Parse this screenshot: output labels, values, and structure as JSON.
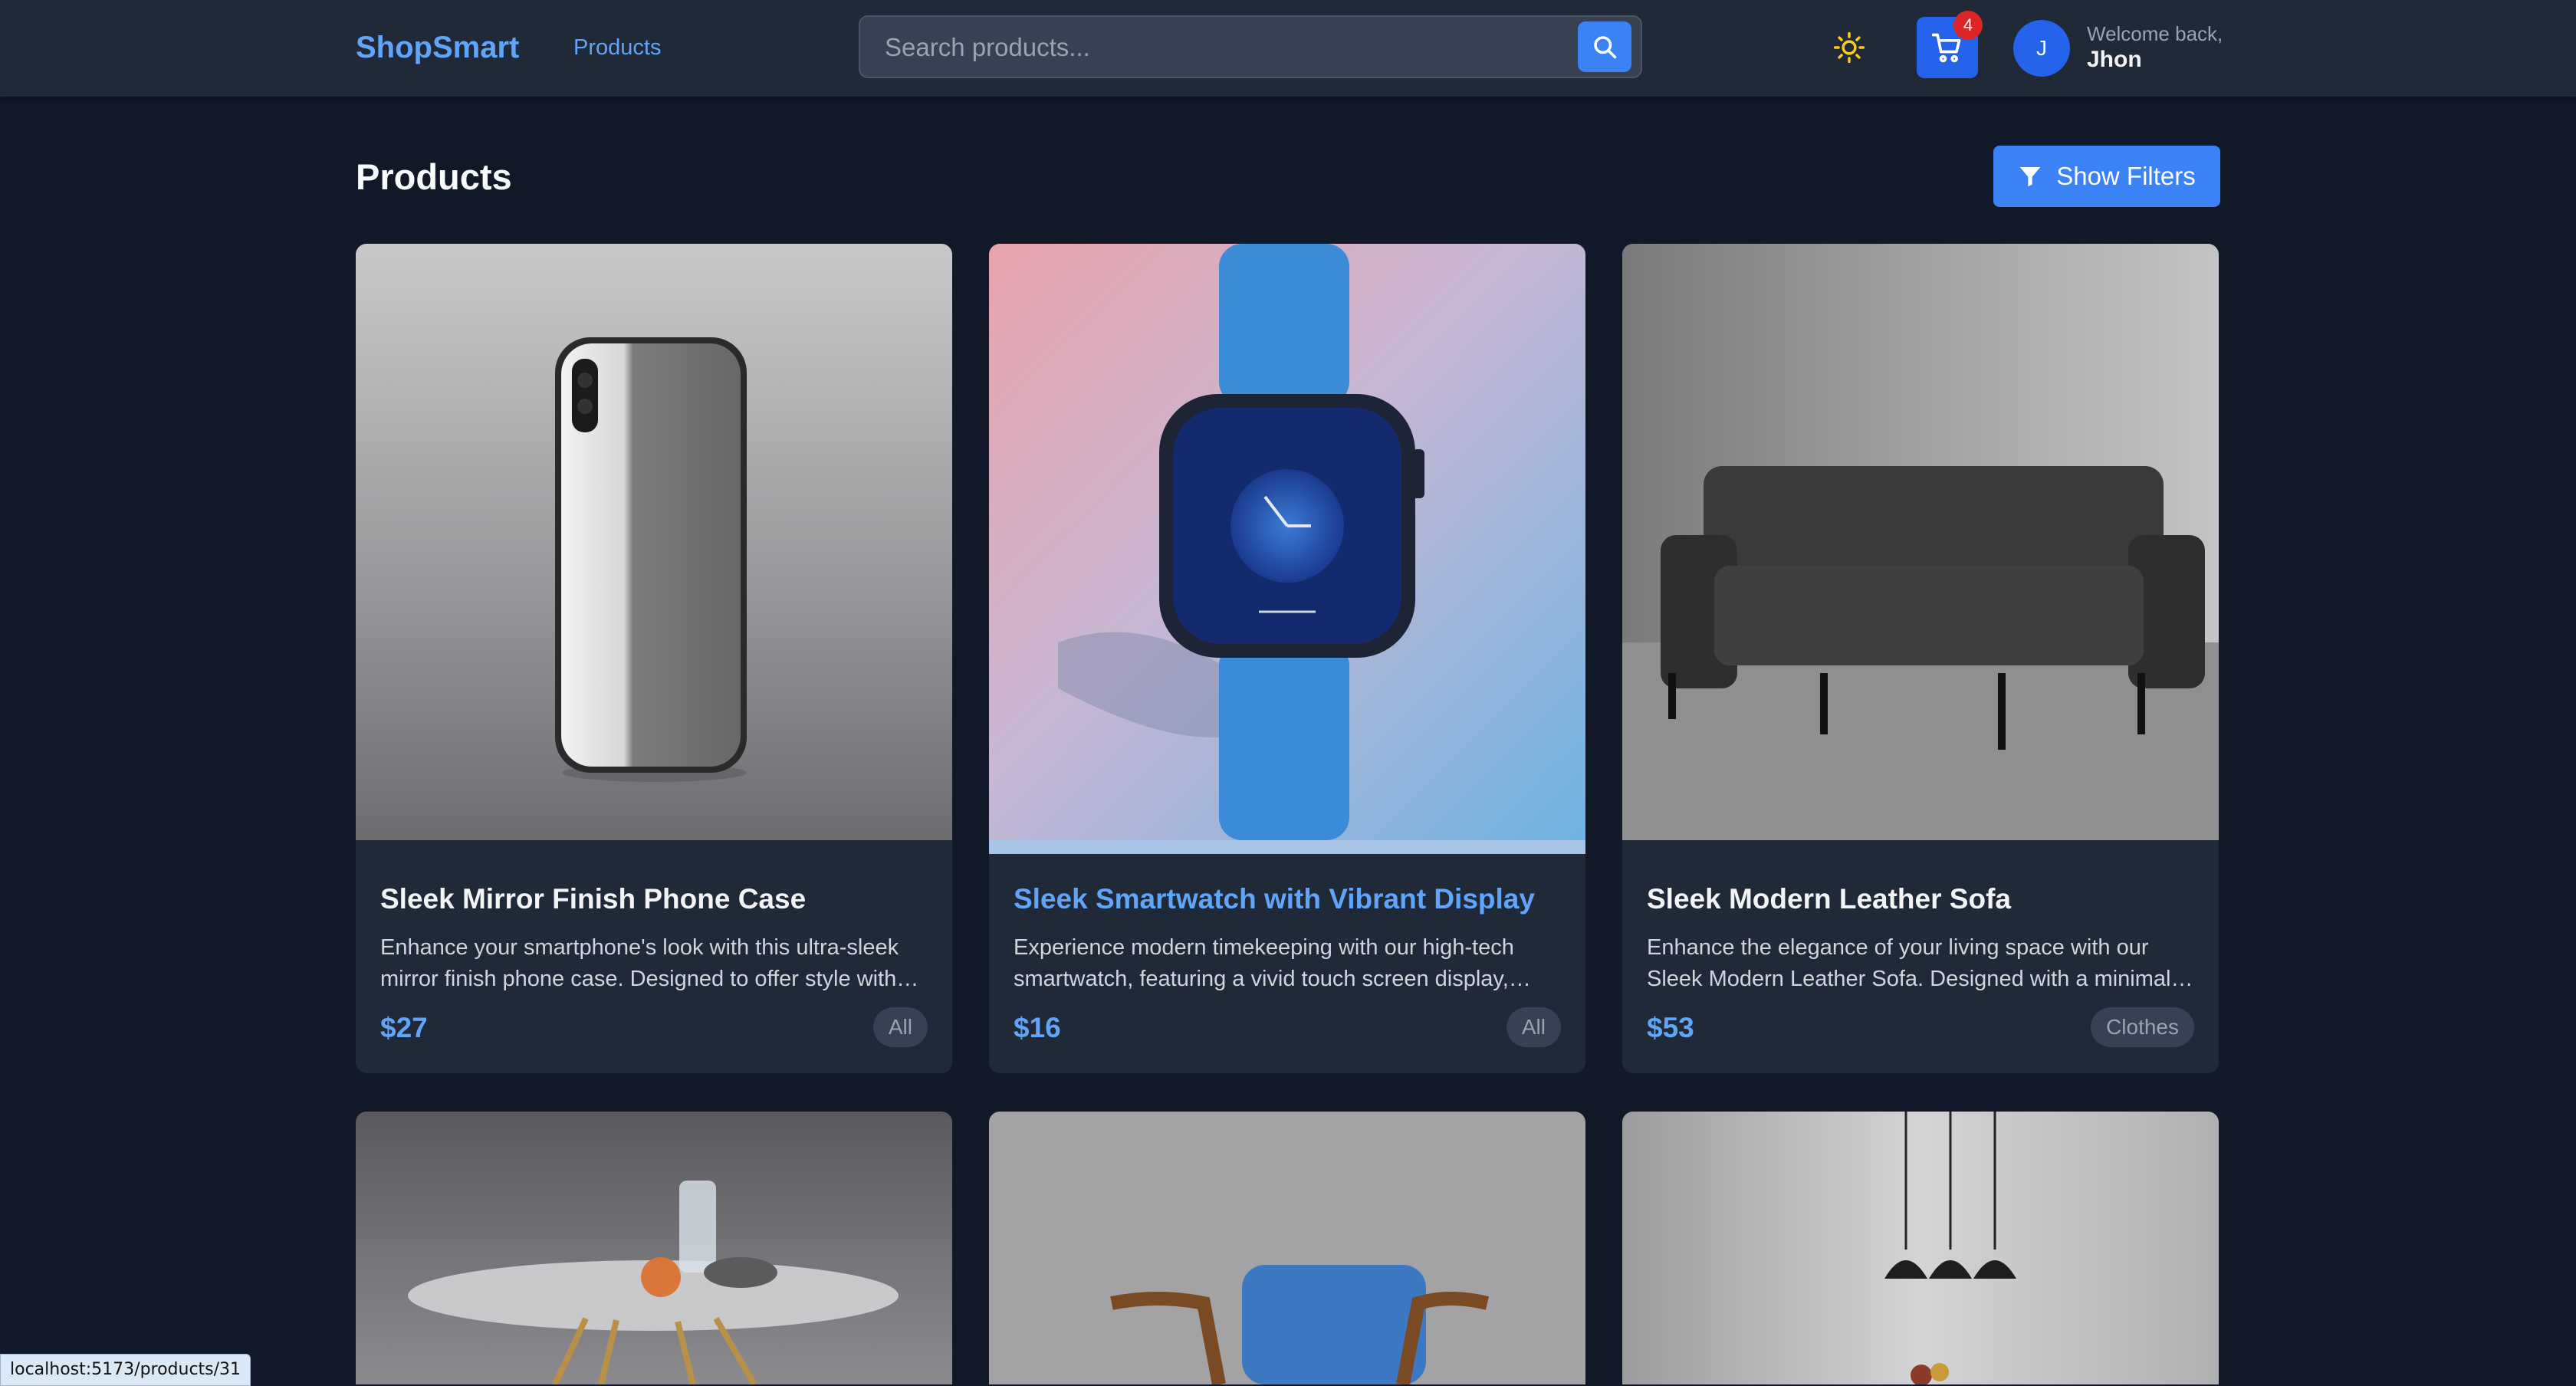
{
  "header": {
    "brand": "ShopSmart",
    "nav_products": "Products",
    "search_placeholder": "Search products...",
    "cart_count": "4",
    "avatar_initial": "J",
    "welcome_text": "Welcome back,",
    "username": "Jhon"
  },
  "page": {
    "title": "Products",
    "filters_button": "Show Filters"
  },
  "products": [
    {
      "title": "Sleek Mirror Finish Phone Case",
      "description": "Enhance your smartphone's look with this ultra-sleek mirror finish phone case. Designed to offer style with durable protection.",
      "price": "$27",
      "category": "All"
    },
    {
      "title": "Sleek Smartwatch with Vibrant Display",
      "description": "Experience modern timekeeping with our high-tech smartwatch, featuring a vivid touch screen display, customizable faces.",
      "price": "$16",
      "category": "All"
    },
    {
      "title": "Sleek Modern Leather Sofa",
      "description": "Enhance the elegance of your living space with our Sleek Modern Leather Sofa. Designed with a minimalist aesthetic.",
      "price": "$53",
      "category": "Clothes"
    }
  ],
  "status_url": "localhost:5173/products/31",
  "colors": {
    "background": "#111827",
    "header": "#1f2937",
    "card": "#1f2937",
    "accent": "#3b82f6",
    "brand": "#60a5fa",
    "badge": "#dc2626"
  }
}
